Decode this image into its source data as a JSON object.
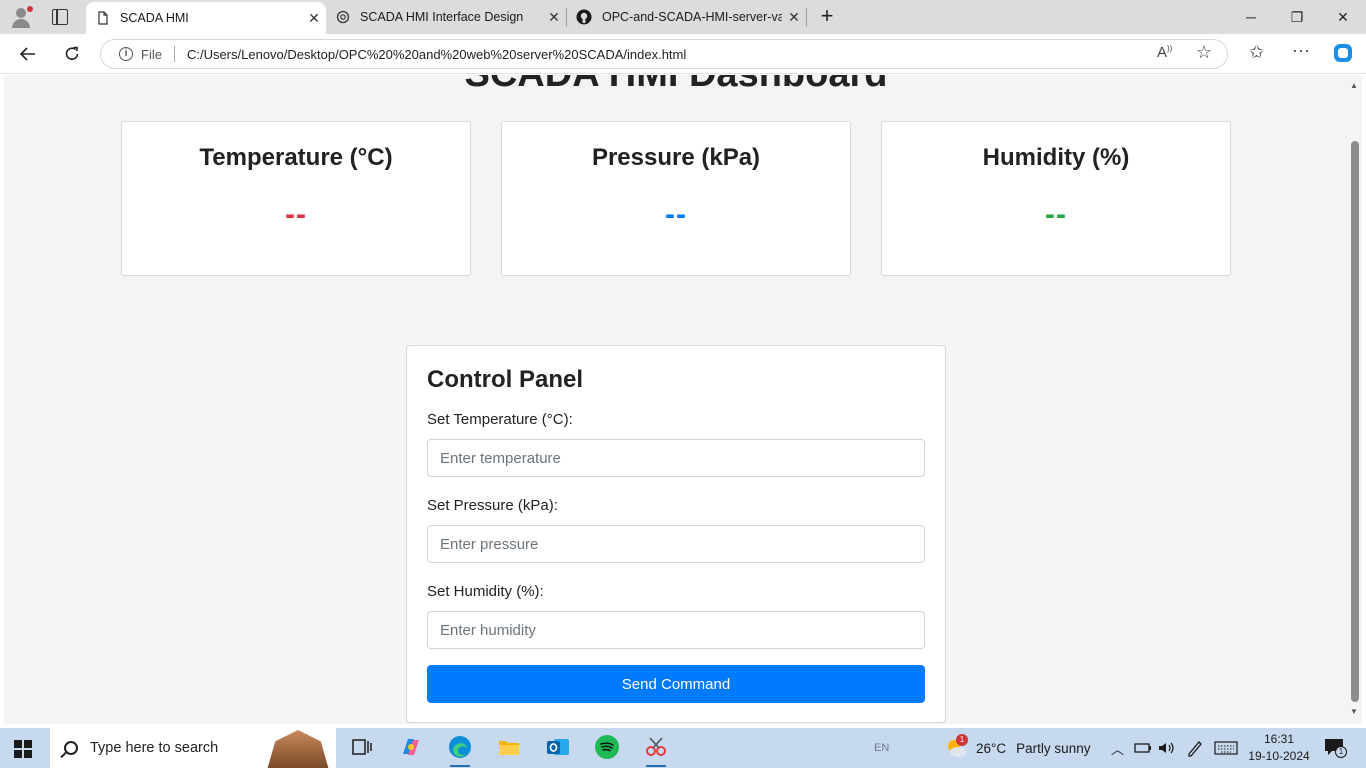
{
  "browser": {
    "tabs": [
      {
        "label": "SCADA HMI",
        "active": true
      },
      {
        "label": "SCADA HMI Interface Design",
        "active": false
      },
      {
        "label": "OPC-and-SCADA-HMI-server-vali",
        "active": false
      }
    ],
    "address": {
      "scheme_label": "File",
      "url": "C:/Users/Lenovo/Desktop/OPC%20%20and%20web%20server%20SCADA/index.html"
    }
  },
  "page": {
    "title": "SCADA HMI Dashboard",
    "cards": [
      {
        "label": "Temperature (°C)",
        "value": "--",
        "color": "#dc3545"
      },
      {
        "label": "Pressure (kPa)",
        "value": "--",
        "color": "#007bff"
      },
      {
        "label": "Humidity (%)",
        "value": "--",
        "color": "#28a745"
      }
    ],
    "control_panel": {
      "title": "Control Panel",
      "fields": [
        {
          "label": "Set Temperature (°C):",
          "placeholder": "Enter temperature"
        },
        {
          "label": "Set Pressure (kPa):",
          "placeholder": "Enter pressure"
        },
        {
          "label": "Set Humidity (%):",
          "placeholder": "Enter humidity"
        }
      ],
      "button": "Send Command",
      "button_color": "#007bff"
    }
  },
  "taskbar": {
    "search_placeholder": "Type here to search",
    "language": "EN",
    "weather": {
      "temp": "26°C",
      "desc": "Partly sunny",
      "badge": "1"
    },
    "time": "16:31",
    "date": "19-10-2024",
    "notifications": "1"
  }
}
